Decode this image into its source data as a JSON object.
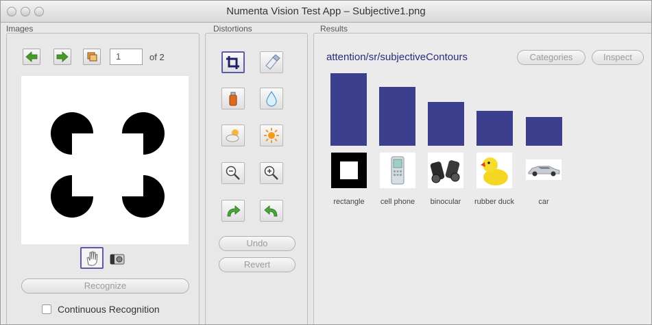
{
  "window": {
    "title": "Numenta Vision Test App – Subjective1.png"
  },
  "panes": {
    "images": "Images",
    "distortions": "Distortions",
    "results": "Results"
  },
  "images": {
    "current_page": "1",
    "of_label": "of 2",
    "recognize_label": "Recognize",
    "continuous_label": "Continuous Recognition",
    "continuous_checked": false
  },
  "distortions": {
    "tools": [
      "crop-icon",
      "eraser-icon",
      "spray-can-icon",
      "water-drop-icon",
      "cloud-sun-icon",
      "sun-icon",
      "zoom-out-icon",
      "zoom-in-icon",
      "rotate-right-icon",
      "rotate-left-icon"
    ],
    "undo_label": "Undo",
    "revert_label": "Revert"
  },
  "results": {
    "network": "attention/sr/subjectiveContours",
    "categories_button": "Categories",
    "inspect_button": "Inspect",
    "bar_color": "#3b3f8d",
    "items": [
      {
        "label": "rectangle",
        "score": 1.0
      },
      {
        "label": "cell phone",
        "score": 0.81
      },
      {
        "label": "binocular",
        "score": 0.6
      },
      {
        "label": "rubber duck",
        "score": 0.48
      },
      {
        "label": "car",
        "score": 0.4
      }
    ]
  }
}
